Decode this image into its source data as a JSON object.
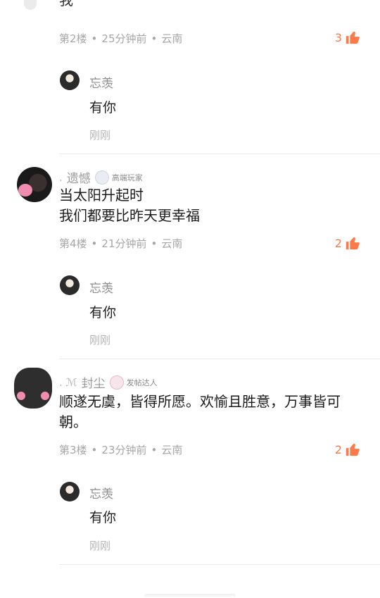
{
  "comments": [
    {
      "text_partial": "我",
      "meta": {
        "floor": "第2楼",
        "time": "25分钟前",
        "location": "云南"
      },
      "likes": "3",
      "reply": {
        "author": "忘羡",
        "text": "有你",
        "time": "刚刚"
      }
    },
    {
      "author": "遗憾",
      "badge": "高端玩家",
      "text_line1": "当太阳升起时",
      "text_line2": "我们都要比昨天更幸福",
      "meta": {
        "floor": "第4楼",
        "time": "21分钟前",
        "location": "云南"
      },
      "likes": "2",
      "reply": {
        "author": "忘羡",
        "text": "有你",
        "time": "刚刚"
      }
    },
    {
      "author": "封尘",
      "badge": "发帖达人",
      "text_line1": "顺遂无虞，皆得所愿。欢愉且胜意，万事皆可",
      "text_line2": "朝。",
      "meta": {
        "floor": "第3楼",
        "time": "23分钟前",
        "location": "云南"
      },
      "likes": "2",
      "reply": {
        "author": "忘羡",
        "text": "有你",
        "time": "刚刚"
      }
    }
  ],
  "colors": {
    "like": "#ff7a4a",
    "meta": "#a6a6a6",
    "divider": "#ececec"
  }
}
